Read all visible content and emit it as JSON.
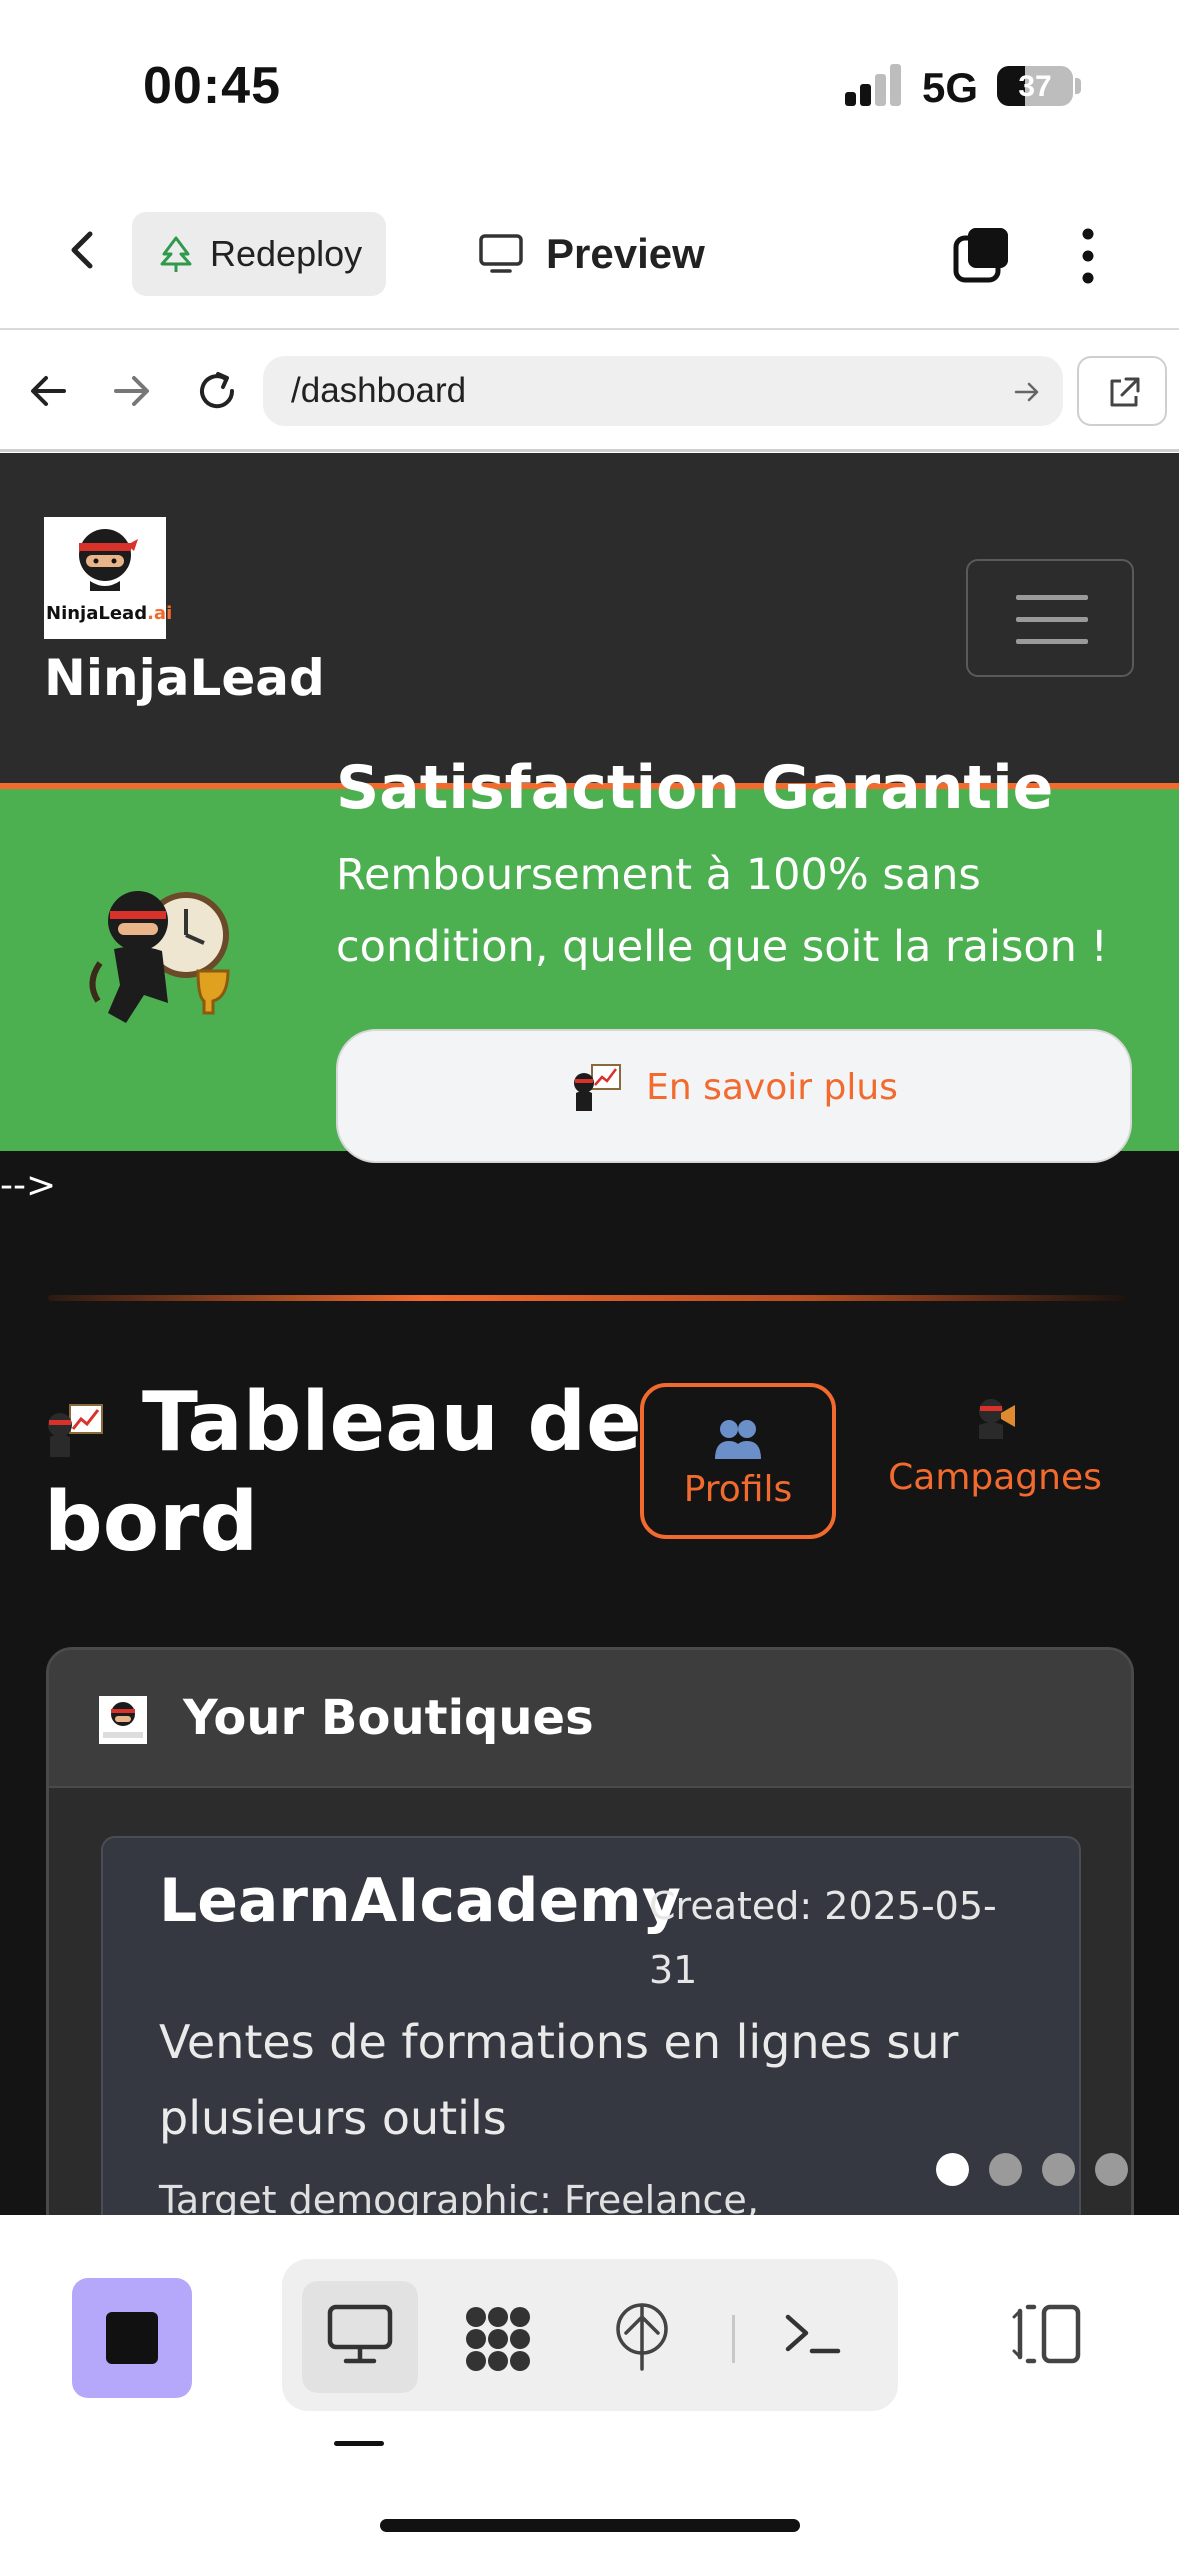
{
  "status_bar": {
    "time": "00:45",
    "network": "5G",
    "battery": "37",
    "battery_level": 0.37
  },
  "app_header": {
    "redeploy_label": "Redeploy",
    "preview_label": "Preview"
  },
  "browser": {
    "url": "/dashboard"
  },
  "site": {
    "logo_text_main": "NinjaLead",
    "logo_text_suffix": ".ai",
    "brand": "NinjaLead",
    "promo": {
      "title": "Satisfaction Garantie",
      "text": "Remboursement à 100% sans condition, quelle que soit la raison !",
      "button_label": "En savoir plus"
    },
    "comment_residue": "-->",
    "dashboard": {
      "title": "Tableau de bord",
      "profils_label": "Profils",
      "campagnes_label": "Campagnes"
    },
    "boutiques": {
      "header": "Your Boutiques",
      "shop_name": "LearnAIcademy",
      "created": "Created: 2025-05-31",
      "description": "Ventes de formations en lignes sur plusieurs outils",
      "target": "Target demographic: Freelance,"
    },
    "carousel_dots": 4,
    "carousel_active": 1
  },
  "colors": {
    "accent_orange": "#f26a2e",
    "promo_green": "#4caf50",
    "site_background": "#141414",
    "stop_button": "#b5a8fb"
  },
  "icons": {
    "back": "chevron-left-icon",
    "redeploy": "tree-icon",
    "preview": "monitor-icon",
    "tabs": "tabs-icon",
    "more": "more-vertical-icon",
    "browser_back": "arrow-left-icon",
    "browser_forward": "arrow-right-icon",
    "reload": "reload-icon",
    "open_external": "external-link-icon",
    "stop": "stop-icon",
    "console": "monitor-icon",
    "agent": "network-icon",
    "deploy": "deploy-icon",
    "shell": "terminal-icon",
    "panel": "side-panel-icon"
  }
}
